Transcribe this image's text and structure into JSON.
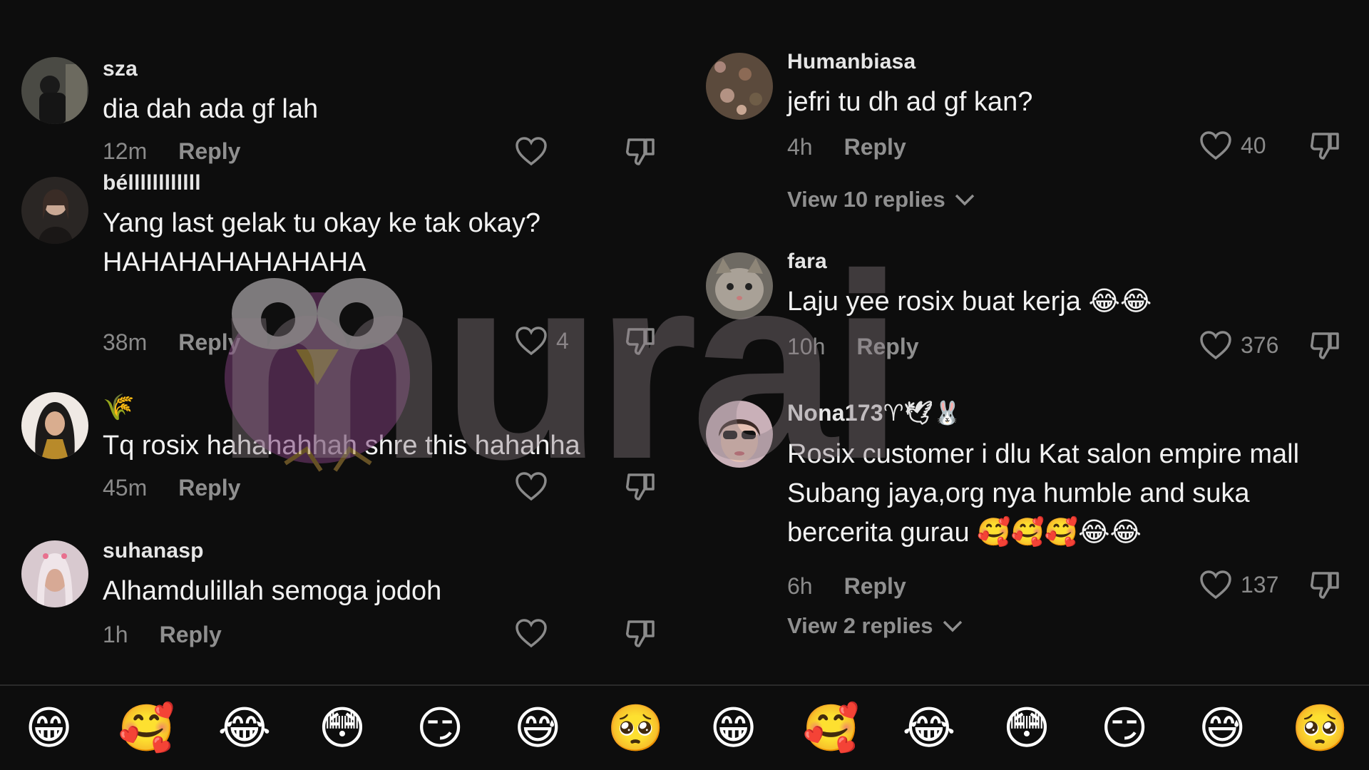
{
  "left_panel": {
    "comments": [
      {
        "username": "sza",
        "text": "dia dah ada gf lah",
        "time": "12m",
        "reply": "Reply",
        "likes": ""
      },
      {
        "username": "béllllllllllll",
        "text": "Yang last gelak tu okay ke tak okay? HAHAHAHAHAHAHA",
        "time": "38m",
        "reply": "Reply",
        "likes": "4"
      },
      {
        "username": "🌾",
        "text": "Tq rosix hahahahhah shre this hahahha",
        "time": "45m",
        "reply": "Reply",
        "likes": ""
      },
      {
        "username": "suhanasp",
        "text": "Alhamdulillah semoga jodoh",
        "time": "1h",
        "reply": "Reply",
        "likes": ""
      }
    ],
    "emoji_bar": [
      "😁",
      "🥰",
      "😂",
      "😳",
      "😏",
      "😅",
      "🥺"
    ]
  },
  "right_panel": {
    "comments": [
      {
        "username": "Humanbiasa",
        "text": "jefri tu dh ad gf kan?",
        "time": "4h",
        "reply": "Reply",
        "likes": "40",
        "view_replies": "View 10 replies"
      },
      {
        "username": "fara",
        "text": "Laju yee rosix buat kerja 😂😂",
        "time": "10h",
        "reply": "Reply",
        "likes": "376"
      },
      {
        "username": "Nona173♈🕊🐰",
        "text": "Rosix customer i dlu Kat salon empire mall Subang jaya,org nya humble and suka bercerita gurau 🥰🥰🥰😂😂",
        "time": "6h",
        "reply": "Reply",
        "likes": "137",
        "view_replies": "View 2 replies"
      }
    ],
    "emoji_bar": [
      "😁",
      "🥰",
      "😂",
      "😳",
      "😏",
      "😅",
      "🥺"
    ]
  },
  "watermark": {
    "text": "murai"
  },
  "colors": {
    "background": "#0d0d0d",
    "text": "#f2f2f2",
    "muted": "#8a8a8a",
    "watermark": "#8a7d84"
  },
  "icons": {
    "like": "heart-outline-icon",
    "dislike": "thumbs-down-icon",
    "chevron": "chevron-down-icon"
  }
}
